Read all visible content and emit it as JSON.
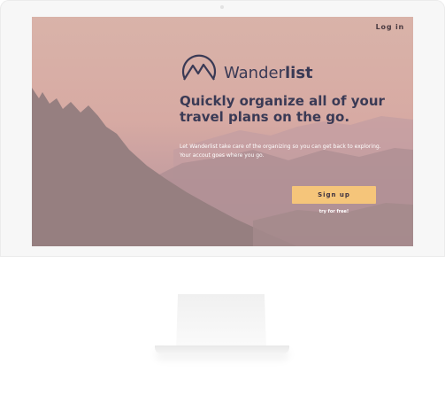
{
  "nav": {
    "login_label": "Log in"
  },
  "brand": {
    "name_light": "Wander",
    "name_bold": "list",
    "logo_icon": "mountain-logo-icon"
  },
  "hero": {
    "headline": "Quickly organize all of your travel plans on the go.",
    "description": "Let Wanderlist take care of the organizing so you can get back to exploring. Your accout goes where you go.",
    "cta_label": "Sign up",
    "cta_sub": "try for free!"
  },
  "colors": {
    "accent": "#f5c57a",
    "text_dark": "#3a3a55",
    "sky": "#d9b3a9"
  }
}
